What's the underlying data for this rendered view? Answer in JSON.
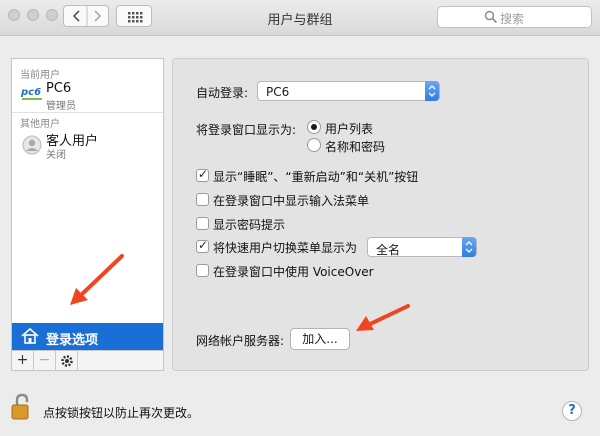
{
  "window": {
    "title": "用户与群组"
  },
  "search": {
    "placeholder": "搜索"
  },
  "sidebar": {
    "current_users_header": "当前用户",
    "current_user": {
      "name": "PC6",
      "role": "管理员",
      "avatar_text": "pc6"
    },
    "other_users_header": "其他用户",
    "guest_user": {
      "name": "客人用户",
      "status": "关闭"
    },
    "login_options_label": "登录选项",
    "tools": {
      "add": "+",
      "remove": "−",
      "gear": "✱"
    }
  },
  "panel": {
    "auto_login_label": "自动登录:",
    "auto_login_value": "PC6",
    "display_login_as_label": "将登录窗口显示为:",
    "radio_options": [
      "用户列表",
      "名称和密码"
    ],
    "radio_selected": 0,
    "checkboxes": [
      {
        "label": "显示“睡眠”、“重新启动”和“关机”按钮",
        "checked": true
      },
      {
        "label": "在登录窗口中显示输入法菜单",
        "checked": false
      },
      {
        "label": "显示密码提示",
        "checked": false
      },
      {
        "label": "将快速用户切换菜单显示为",
        "checked": true
      },
      {
        "label": "在登录窗口中使用 VoiceOver",
        "checked": false
      }
    ],
    "fast_switch_value": "全名",
    "network_server_label": "网络帐户服务器:",
    "join_button": "加入..."
  },
  "footer": {
    "lock_text": "点按锁按钮以防止再次更改。",
    "help": "?"
  },
  "colors": {
    "selection": "#1a6fd6",
    "arrow": "#ef4523"
  }
}
